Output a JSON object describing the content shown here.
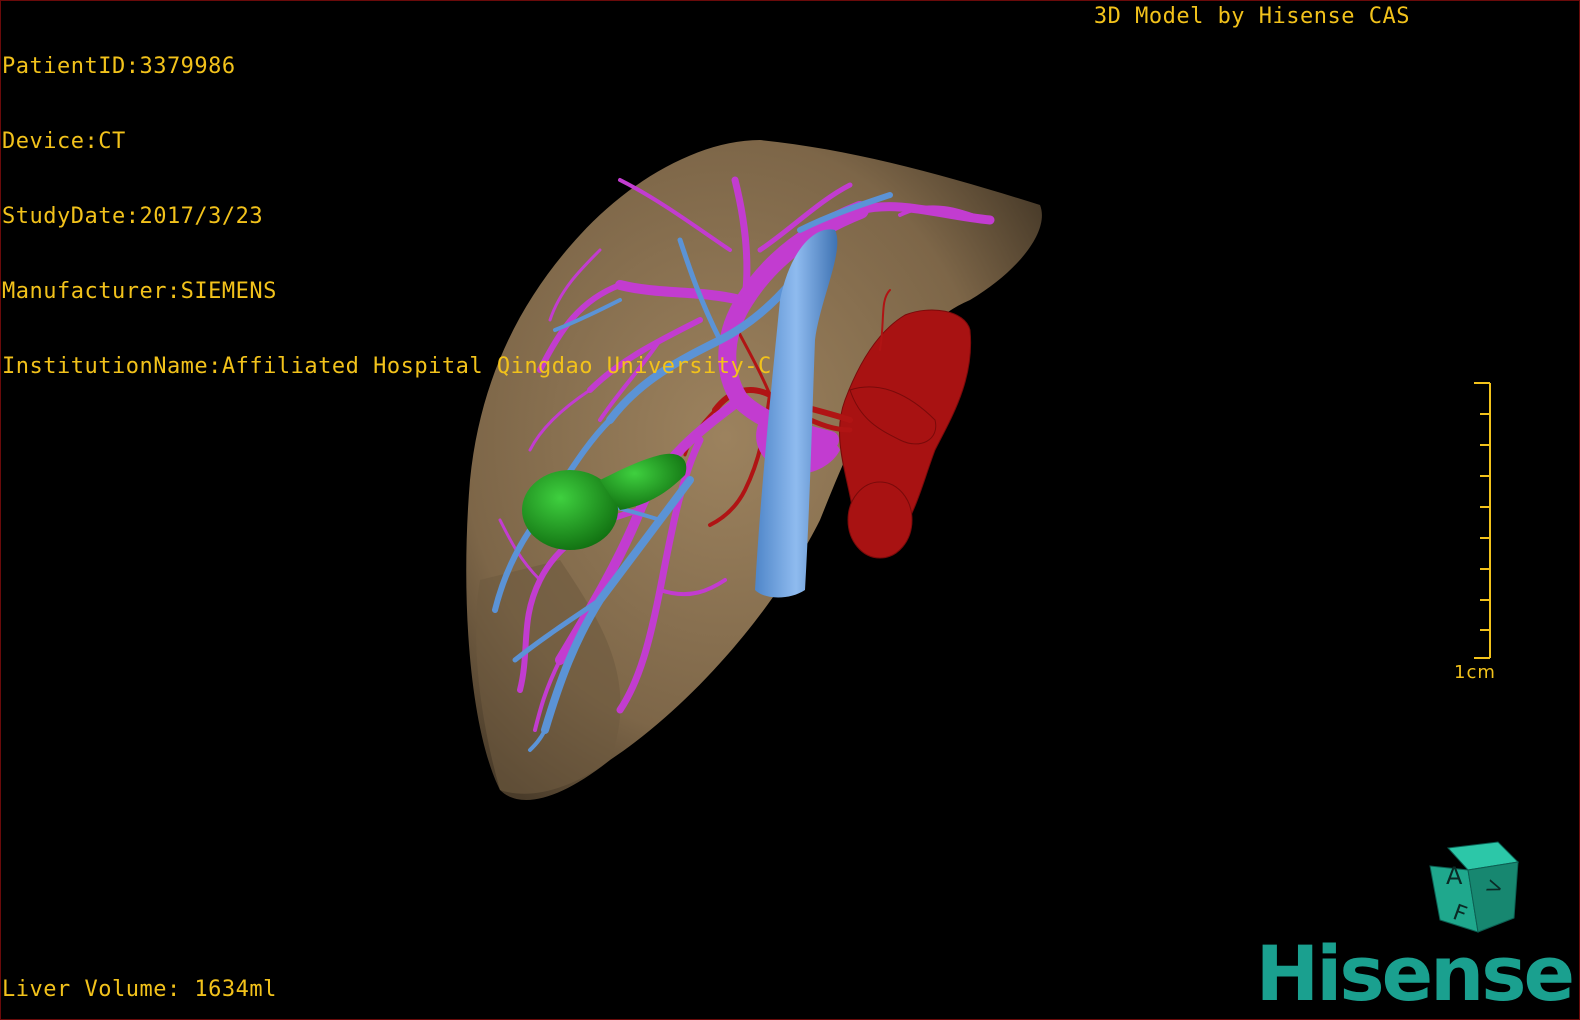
{
  "info": {
    "patient_id": "PatientID:3379986",
    "device": "Device:CT",
    "study_date": "StudyDate:2017/3/23",
    "manufacturer": "Manufacturer:SIEMENS",
    "institution": "InstitutionName:Affiliated Hospital Qingdao University-C"
  },
  "credit": "3D Model by Hisense CAS",
  "liver_volume": "Liver Volume: 1634ml",
  "scale": {
    "label": "1cm"
  },
  "orientation_cube": {
    "labels": [
      "A",
      "F",
      "V"
    ]
  },
  "brand": "Hisense",
  "colors": {
    "text": "#f2c21b",
    "liver": "#8a7150",
    "portal_vein": "#c23cd0",
    "hepatic_vein": "#5b93d6",
    "artery": "#b01414",
    "gallbladder": "#1f9a1f",
    "brand": "#1aa08f"
  }
}
